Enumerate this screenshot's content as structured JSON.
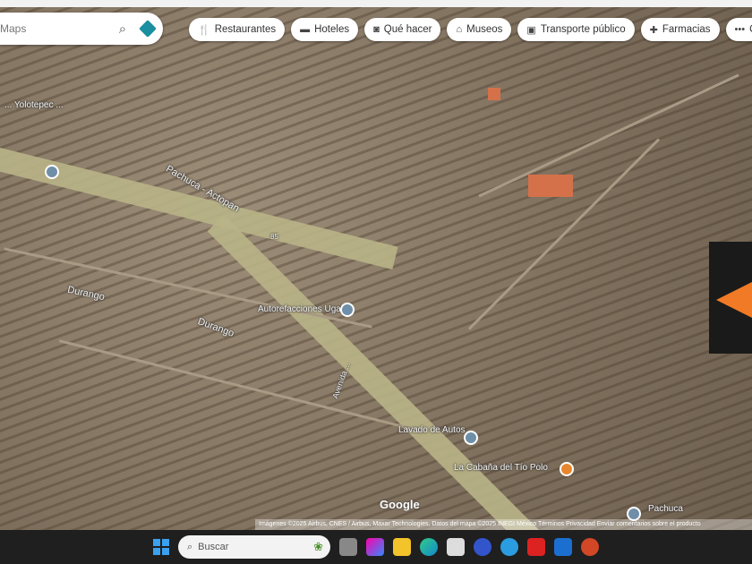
{
  "search": {
    "placeholder": "Maps"
  },
  "chips": [
    {
      "icon": "restaurant-icon",
      "glyph": "🍴",
      "label": "Restaurantes"
    },
    {
      "icon": "hotel-icon",
      "glyph": "▬",
      "label": "Hoteles"
    },
    {
      "icon": "camera-icon",
      "glyph": "◙",
      "label": "Qué hacer"
    },
    {
      "icon": "museum-icon",
      "glyph": "⌂",
      "label": "Museos"
    },
    {
      "icon": "transit-icon",
      "glyph": "▣",
      "label": "Transporte público"
    },
    {
      "icon": "pharmacy-icon",
      "glyph": "✚",
      "label": "Farmacias"
    },
    {
      "icon": "more-icon",
      "glyph": "•••",
      "label": "Ca"
    }
  ],
  "map": {
    "labels": {
      "highway": "Pachuca - Actopan",
      "street1": "Durango",
      "street2": "Durango",
      "street3": "Avenida ...",
      "place1": "Autorefacciones Ugalde",
      "place2": "Lavado de Autos",
      "place3": "La Cabaña del Tío Polo",
      "place4": "Pachuca",
      "place5": "... Yolotepec ...",
      "route": "85"
    },
    "google": "Google",
    "attribution": "Imágenes ©2025 Airbus, CNES / Airbus, Maxar Technologies, Datos del mapa ©2025 INEGI   México   Términos   Privacidad   Enviar comentarios sobre el producto"
  },
  "taskbar": {
    "search_placeholder": "Buscar"
  }
}
